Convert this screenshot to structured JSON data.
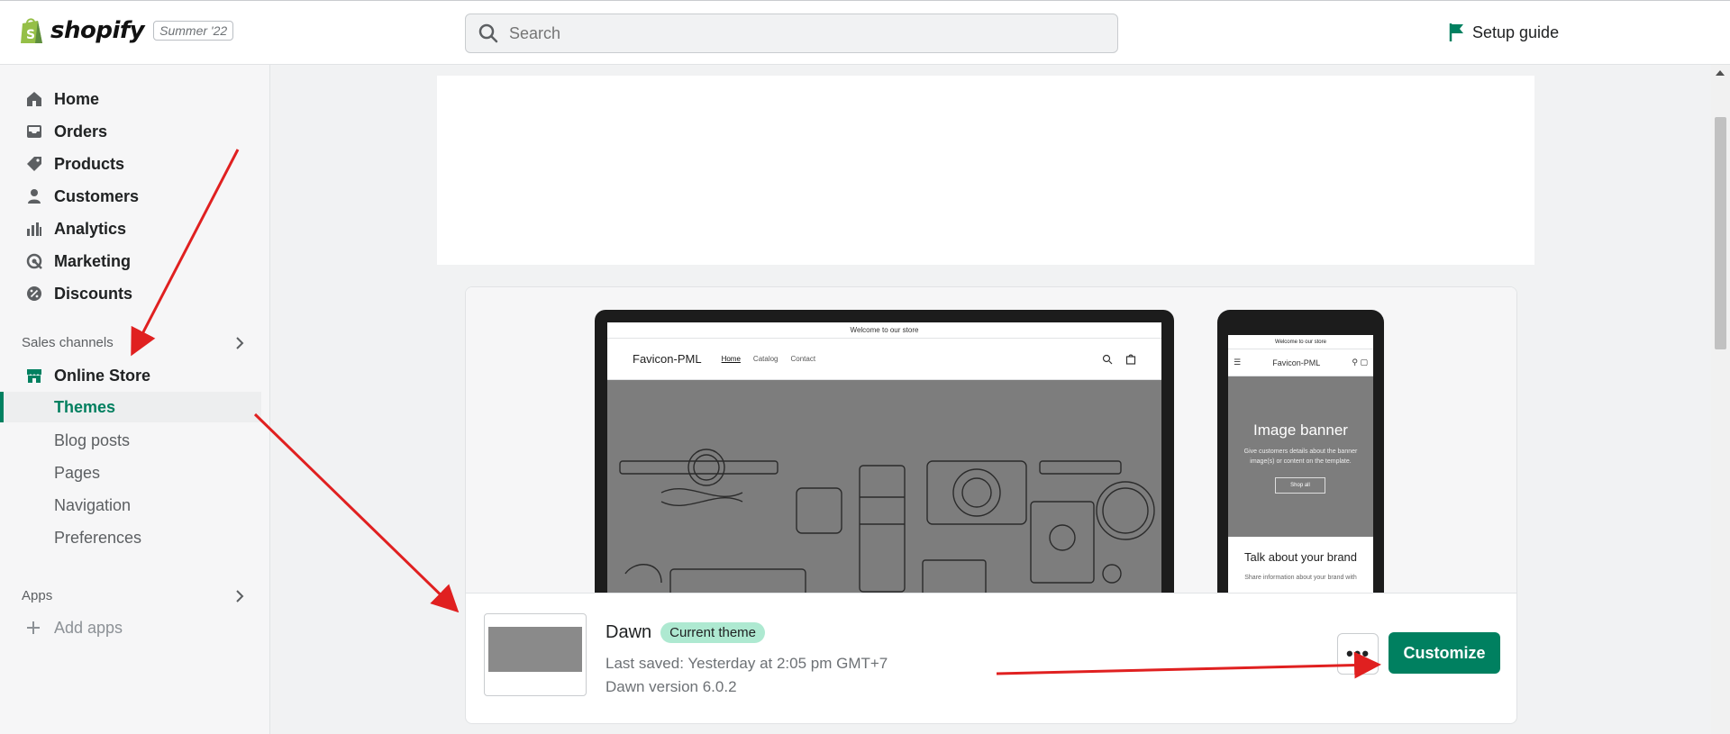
{
  "header": {
    "brand": "shopify",
    "edition_badge": "Summer '22",
    "search_placeholder": "Search",
    "setup_guide": "Setup guide"
  },
  "sidebar": {
    "items": [
      {
        "label": "Home",
        "icon": "home-icon"
      },
      {
        "label": "Orders",
        "icon": "orders-icon"
      },
      {
        "label": "Products",
        "icon": "tag-icon"
      },
      {
        "label": "Customers",
        "icon": "person-icon"
      },
      {
        "label": "Analytics",
        "icon": "bar-chart-icon"
      },
      {
        "label": "Marketing",
        "icon": "target-icon"
      },
      {
        "label": "Discounts",
        "icon": "discount-icon"
      }
    ],
    "sales_channels_label": "Sales channels",
    "online_store": "Online Store",
    "sub_items": [
      "Themes",
      "Blog posts",
      "Pages",
      "Navigation",
      "Preferences"
    ],
    "apps_label": "Apps",
    "add_apps": "Add apps"
  },
  "theme": {
    "preview": {
      "announcement": "Welcome to our store",
      "store_name": "Favicon-PML",
      "links": [
        "Home",
        "Catalog",
        "Contact"
      ],
      "mobile_banner_title": "Image banner",
      "mobile_banner_text": "Give customers details about the banner image(s) or content on the template.",
      "mobile_banner_button": "Shop all",
      "mobile_talk": "Talk about your brand",
      "mobile_info": "Share information about your brand with"
    },
    "name": "Dawn",
    "badge": "Current theme",
    "last_saved": "Last saved: Yesterday at 2:05 pm GMT+7",
    "version": "Dawn version 6.0.2",
    "more_label": "•••",
    "customize_label": "Customize"
  },
  "colors": {
    "brand_green": "#008060",
    "badge_green": "#aee9d1",
    "annotation_red": "#e02020"
  }
}
